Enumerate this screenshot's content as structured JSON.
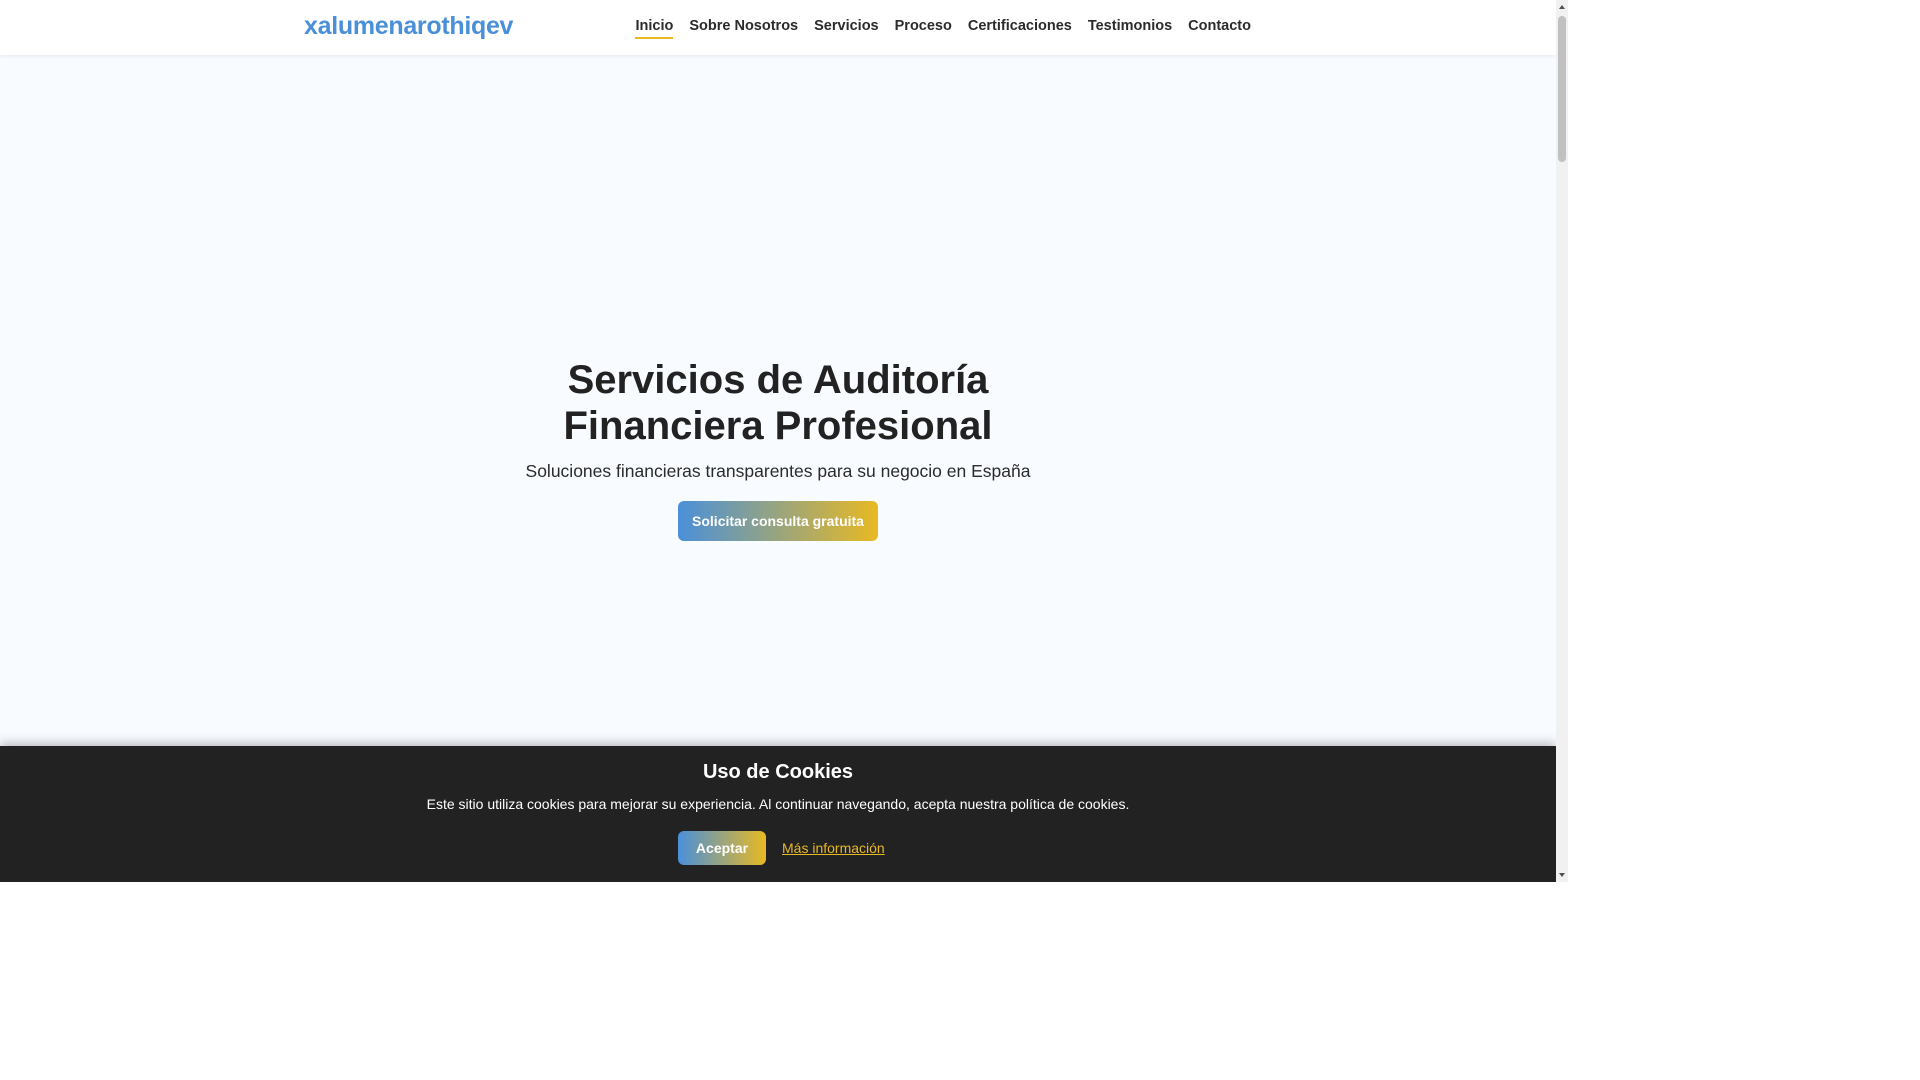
{
  "site": {
    "brand": "xalumenarothiqev"
  },
  "nav": {
    "items": [
      {
        "label": "Inicio",
        "active": true
      },
      {
        "label": "Sobre Nosotros",
        "active": false
      },
      {
        "label": "Servicios",
        "active": false
      },
      {
        "label": "Proceso",
        "active": false
      },
      {
        "label": "Certificaciones",
        "active": false
      },
      {
        "label": "Testimonios",
        "active": false
      },
      {
        "label": "Contacto",
        "active": false
      }
    ]
  },
  "hero": {
    "title_line1": "Servicios de Auditoría",
    "title_line2": "Financiera Profesional",
    "subtitle": "Soluciones financieras transparentes para su negocio en España",
    "cta_label": "Solicitar consulta gratuita"
  },
  "cookie_banner": {
    "title": "Uso de Cookies",
    "text": "Este sitio utiliza cookies para mejorar su experiencia. Al continuar navegando, acepta nuestra política de cookies.",
    "accept_label": "Aceptar",
    "more_label": "Más información"
  },
  "colors": {
    "brand_blue": "#4a90d9",
    "accent_gold": "#e8b923",
    "banner_bg": "#222222",
    "hero_bg": "#f8fbff"
  }
}
